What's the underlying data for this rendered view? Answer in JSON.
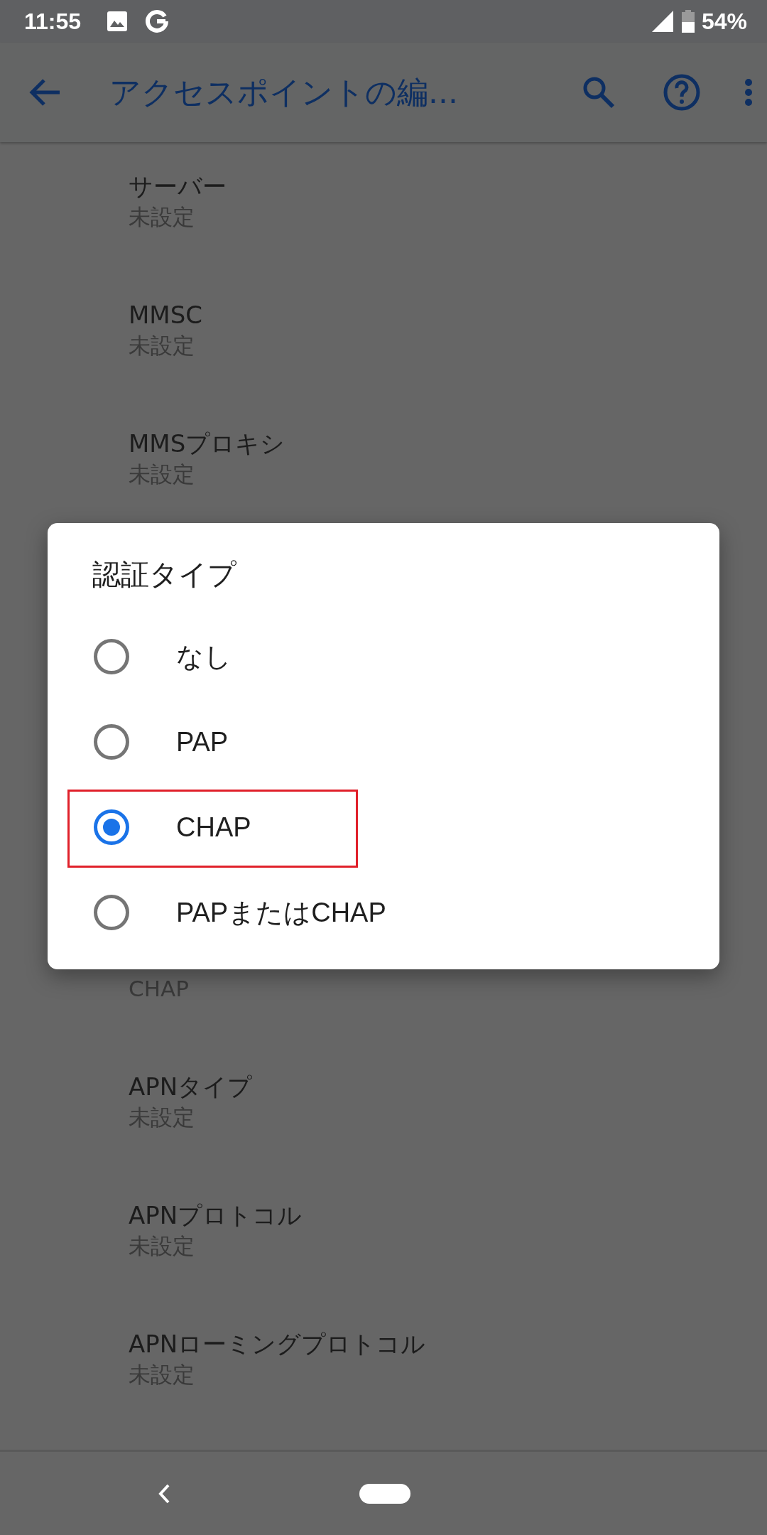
{
  "status_bar": {
    "time": "11:55",
    "battery": "54%"
  },
  "app_bar": {
    "title": "アクセスポイントの編..."
  },
  "settings": [
    {
      "title": "サーバー",
      "summary": "未設定"
    },
    {
      "title": "MMSC",
      "summary": "未設定"
    },
    {
      "title": "MMSプロキシ",
      "summary": "未設定"
    },
    {
      "summary": "CHAP"
    },
    {
      "title": "APNタイプ",
      "summary": "未設定"
    },
    {
      "title": "APNプロトコル",
      "summary": "未設定"
    },
    {
      "title": "APNローミングプロトコル",
      "summary": "未設定"
    }
  ],
  "dialog": {
    "title": "認証タイプ",
    "options": [
      {
        "label": "なし",
        "selected": false,
        "highlighted": false
      },
      {
        "label": "PAP",
        "selected": false,
        "highlighted": false
      },
      {
        "label": "CHAP",
        "selected": true,
        "highlighted": true
      },
      {
        "label": "PAPまたはCHAP",
        "selected": false,
        "highlighted": false
      }
    ]
  }
}
